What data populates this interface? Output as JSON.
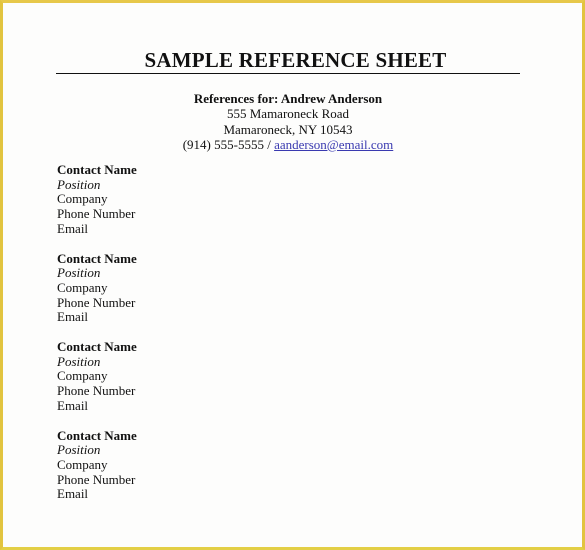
{
  "document": {
    "title": "SAMPLE REFERENCE SHEET",
    "header": {
      "references_for": "References for: Andrew Anderson",
      "address_line1": "555 Mamaroneck Road",
      "address_line2": "Mamaroneck, NY 10543",
      "phone": "(914) 555-5555 / ",
      "email": "aanderson@email.com"
    },
    "contacts": [
      {
        "name": "Contact Name",
        "position": "Position",
        "company": "Company",
        "phone": "Phone Number",
        "email": "Email"
      },
      {
        "name": "Contact Name",
        "position": "Position",
        "company": "Company",
        "phone": "Phone Number",
        "email": "Email"
      },
      {
        "name": "Contact Name",
        "position": "Position",
        "company": "Company",
        "phone": "Phone Number",
        "email": "Email"
      },
      {
        "name": "Contact Name",
        "position": "Position",
        "company": "Company",
        "phone": "Phone Number",
        "email": "Email"
      }
    ]
  },
  "colors": {
    "frame": "#e2c43f",
    "link": "#3a3ab0",
    "text": "#111111"
  }
}
